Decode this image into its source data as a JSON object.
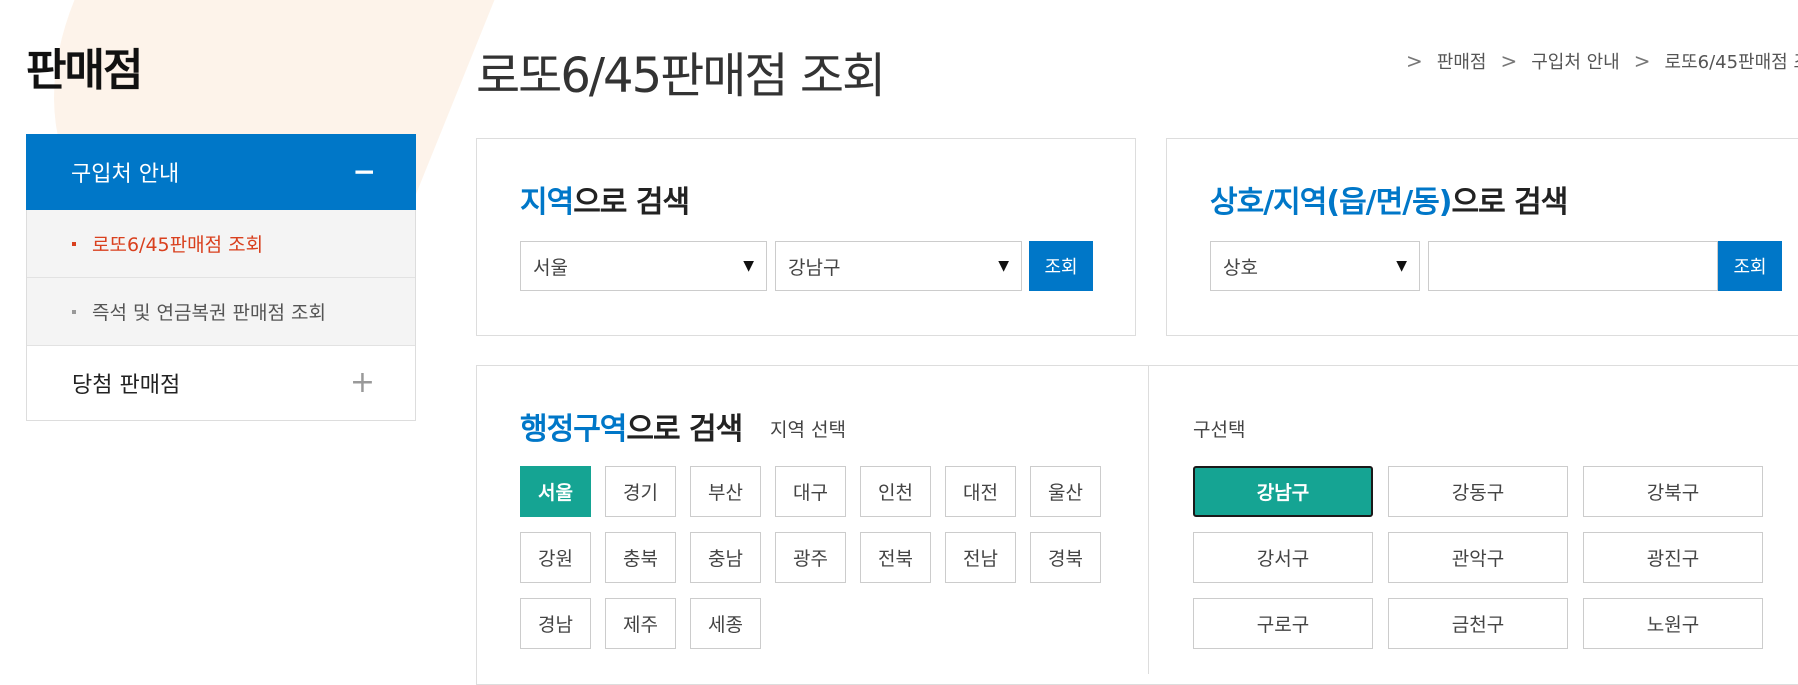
{
  "sidebar": {
    "title": "판매점",
    "menu_head": {
      "label": "구입처 안내",
      "toggle": "−"
    },
    "sub_items": [
      {
        "label": "로또6/45판매점 조회",
        "active": true
      },
      {
        "label": "즉석 및 연금복권 판매점 조회",
        "active": false
      }
    ],
    "menu_item": {
      "label": "당첨 판매점",
      "toggle": "+"
    }
  },
  "page": {
    "title": "로또6/45판매점 조회"
  },
  "breadcrumb": {
    "home_icon": "home-icon",
    "items": [
      "판매점",
      "구입처 안내",
      "로또6/45판매점 조"
    ],
    "separator": ">"
  },
  "region_search": {
    "title_highlight": "지역",
    "title_rest": "으로 검색",
    "sido_selected": "서울",
    "gugun_selected": "강남구",
    "button_label": "조회"
  },
  "name_search": {
    "title_highlight": "상호/지역(읍/면/동)",
    "title_rest": "으로 검색",
    "type_selected": "상호",
    "input_value": "",
    "input_placeholder": "",
    "button_label": "조회"
  },
  "admin_search": {
    "title_highlight": "행정구역",
    "title_rest": "으로 검색",
    "region_label": "지역 선택",
    "regions": [
      "서울",
      "경기",
      "부산",
      "대구",
      "인천",
      "대전",
      "울산",
      "강원",
      "충북",
      "충남",
      "광주",
      "전북",
      "전남",
      "경북",
      "경남",
      "제주",
      "세종"
    ],
    "selected_region": "서울",
    "gu_label": "구선택",
    "gu_list": [
      "강남구",
      "강동구",
      "강북구",
      "강서구",
      "관악구",
      "광진구",
      "구로구",
      "금천구",
      "노원구"
    ],
    "selected_gu": "강남구"
  },
  "colors": {
    "primary_blue": "#0077c8",
    "selected_teal": "#15a493",
    "active_red": "#d9401e"
  }
}
